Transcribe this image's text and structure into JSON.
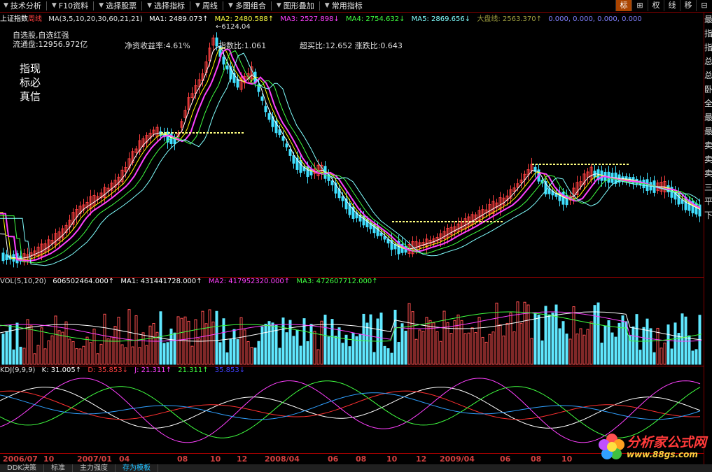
{
  "toolbar": {
    "items": [
      {
        "label": "技术分析"
      },
      {
        "label": "F10资料"
      },
      {
        "label": "选择股票"
      },
      {
        "label": "选择指标"
      },
      {
        "label": "周线"
      },
      {
        "label": "多图组合"
      },
      {
        "label": "图形叠加"
      },
      {
        "label": "常用指标"
      }
    ],
    "right_buttons": [
      "标",
      "⊞",
      "权",
      "线",
      "移",
      "⊟"
    ]
  },
  "header": {
    "stock_name": "上证指数",
    "period": "周线",
    "ma_params": "MA(3,5,10,20,30,60,21,21)",
    "ma1": "MA1: 2489.073↑",
    "ma2": "MA2: 2480.588↑",
    "ma3": "MA3: 2527.898↓",
    "ma4": "MA4: 2754.632↓",
    "ma5": "MA5: 2869.656↓",
    "dapan": "大盘线: 2563.370↑",
    "extra": "0.000, 0.000, 0.000, 0.000"
  },
  "info": {
    "line1": "自选股,自选红强",
    "line2": "流通盘:12956.972亿",
    "roe": "净资收益率:4.61%",
    "ratio": "指数比:1.061",
    "buy": "超买比:12.652 涨跌比:0.643",
    "peak": "6124.04",
    "side": "指现标必真信"
  },
  "vol": {
    "params": "VOL(5,10,20)",
    "value": "606502464.000↑",
    "ma1": "MA1: 431441728.000↑",
    "ma2": "MA2: 417952320.000↑",
    "ma3": "MA3: 472607712.000↑"
  },
  "kdj": {
    "params": "KDJ(9,9,9)",
    "k": "K: 31.005↑",
    "d": "D: 35.853↓",
    "j": "J: 21.311↑",
    "x1": "21.311↑",
    "x2": "35.853↓"
  },
  "dates": [
    "2006/07",
    "10",
    "2007/01",
    "04",
    "08",
    "10",
    "12",
    "2008/04",
    "06",
    "08",
    "10",
    "12",
    "2009/04",
    "06",
    "08",
    "10"
  ],
  "tabs": [
    {
      "label": "DDK决策",
      "active": false
    },
    {
      "label": "标准",
      "active": false
    },
    {
      "label": "主力强度",
      "active": false
    },
    {
      "label": "存为模板",
      "active": true
    }
  ],
  "right_panel": [
    "最",
    "指",
    "指",
    "总",
    "总",
    "卧",
    "全",
    "最",
    "最",
    "卖",
    "卖",
    "卖",
    "三",
    "平",
    "下"
  ],
  "watermark": {
    "title": "分析家公式网",
    "url": "www.88gs.com"
  },
  "colors": {
    "up": "#ff4040",
    "down": "#40e0ff",
    "ma1": "#ffffff",
    "ma2": "#ffff00",
    "ma3": "#ff00ff",
    "ma4": "#00ff00",
    "ma5": "#80ffff",
    "grid": "#a00000"
  }
}
